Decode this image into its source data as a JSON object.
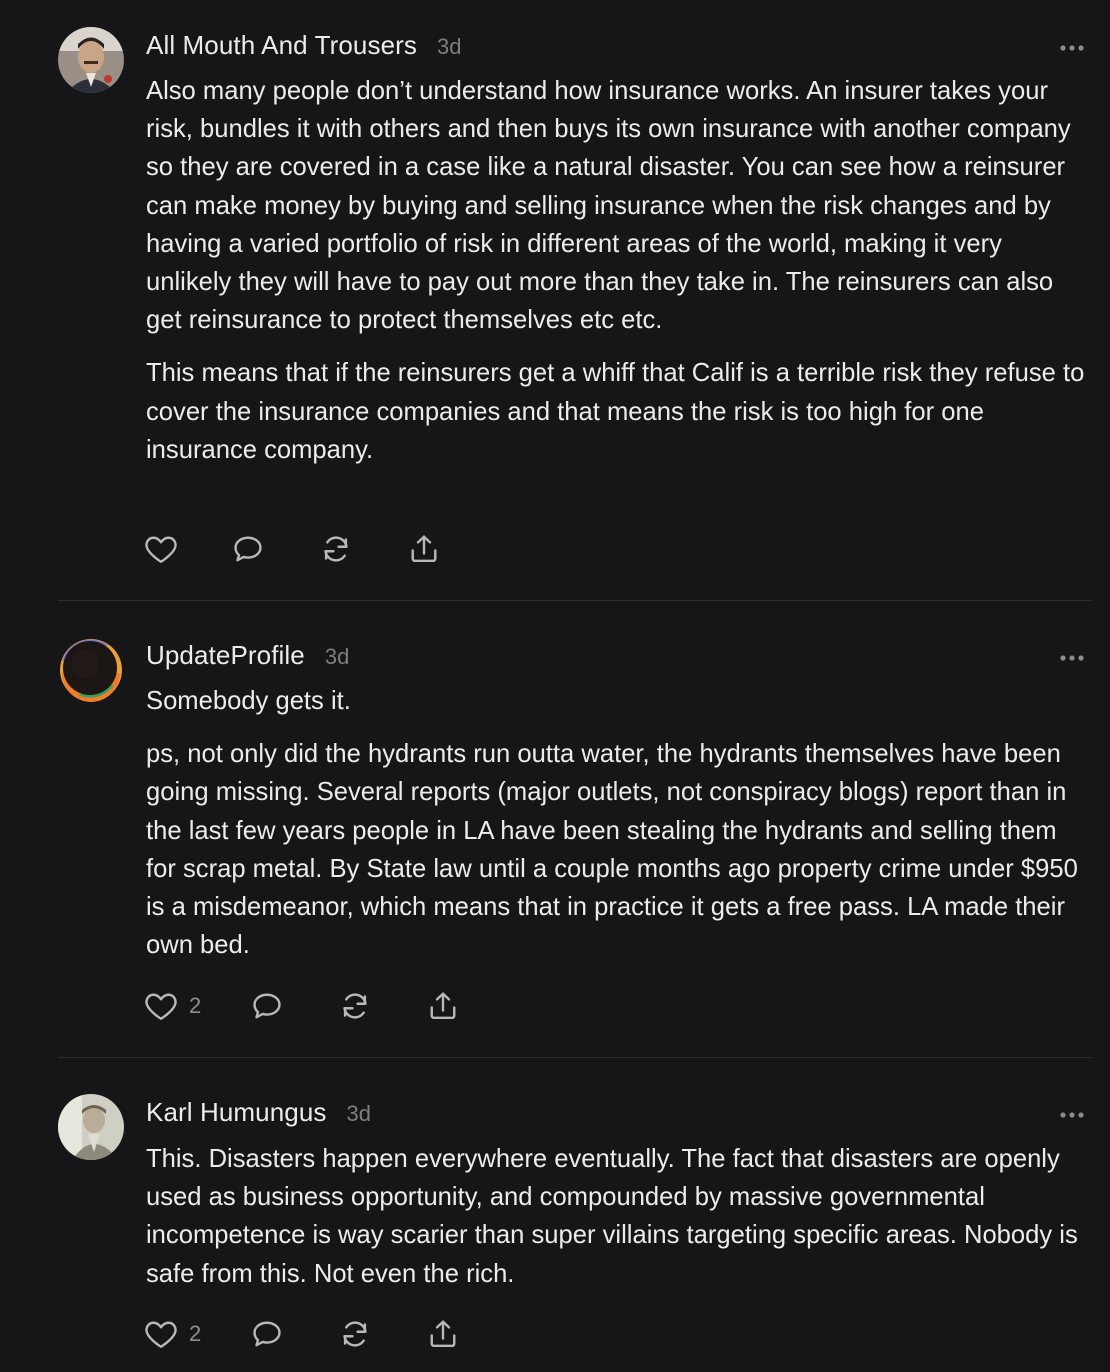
{
  "colors": {
    "background": "#161618",
    "text": "#ececec",
    "muted": "#7d7d82",
    "divider": "#2e2e32"
  },
  "comments": [
    {
      "author": "All Mouth And Trousers",
      "time": "3d",
      "avatar_icon": "avatar-photo-man-mustache",
      "paragraphs": [
        "Also many people don’t understand how insurance works. An insurer takes your risk, bundles it with others and then buys its own insurance with another company so they are covered in a case like a natural disaster. You can see how a reinsurer can make money by buying and selling insurance when the risk changes and by having a varied portfolio of risk in different areas of the world, making it very unlikely they will have to pay out more than they take in. The reinsurers can also get reinsurance to protect themselves etc etc.",
        "This means that if the reinsurers get a whiff that Calif is a terrible risk they refuse to cover the insurance companies and that means the risk is too high for one insurance company."
      ],
      "likes": "",
      "actions": [
        "heart-icon",
        "comment-icon",
        "restack-icon",
        "share-icon"
      ]
    },
    {
      "author": "UpdateProfile",
      "time": "3d",
      "avatar_icon": "avatar-eclipse-ring",
      "paragraphs": [
        "Somebody gets it.",
        "ps, not only did the hydrants run outta water, the hydrants themselves have been going missing. Several reports (major outlets, not conspiracy blogs) report than in the last few years people in LA have been stealing the hydrants and selling them for scrap metal. By State law until a couple months ago property crime under $950 is a misdemeanor, which means that in practice it gets a free pass. LA made their own bed."
      ],
      "likes": "2",
      "actions": [
        "heart-icon",
        "comment-icon",
        "restack-icon",
        "share-icon"
      ]
    },
    {
      "author": "Karl Humungus",
      "time": "3d",
      "avatar_icon": "avatar-photo-sepia-man",
      "paragraphs": [
        "This. Disasters happen everywhere eventually. The fact that disasters are openly used as business opportunity, and compounded by massive governmental incompetence is way scarier than super villains targeting specific areas. Nobody is safe from this. Not even the rich."
      ],
      "likes": "2",
      "actions": [
        "heart-icon",
        "comment-icon",
        "restack-icon",
        "share-icon"
      ]
    }
  ]
}
